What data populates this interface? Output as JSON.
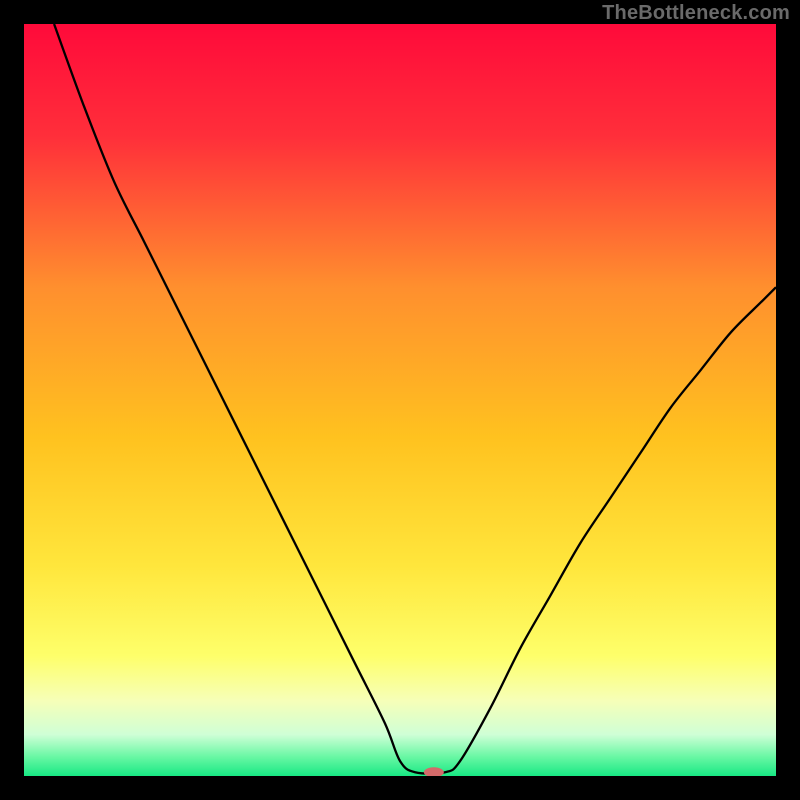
{
  "watermark": "TheBottleneck.com",
  "chart_data": {
    "type": "line",
    "title": "",
    "xlabel": "",
    "ylabel": "",
    "xlim": [
      0,
      100
    ],
    "ylim": [
      0,
      100
    ],
    "background_gradient": {
      "stops": [
        {
          "offset": 0.0,
          "color": "#ff0a3a"
        },
        {
          "offset": 0.15,
          "color": "#ff2f3a"
        },
        {
          "offset": 0.35,
          "color": "#ff8f2e"
        },
        {
          "offset": 0.55,
          "color": "#ffc21f"
        },
        {
          "offset": 0.72,
          "color": "#ffe63c"
        },
        {
          "offset": 0.84,
          "color": "#feff6a"
        },
        {
          "offset": 0.9,
          "color": "#f6ffb8"
        },
        {
          "offset": 0.945,
          "color": "#cfffd6"
        },
        {
          "offset": 0.975,
          "color": "#67f7a3"
        },
        {
          "offset": 1.0,
          "color": "#18e884"
        }
      ]
    },
    "series": [
      {
        "name": "bottleneck-curve",
        "color": "#000000",
        "width": 2.3,
        "points": [
          {
            "x": 4,
            "y": 100
          },
          {
            "x": 8,
            "y": 89
          },
          {
            "x": 12,
            "y": 79
          },
          {
            "x": 16,
            "y": 71
          },
          {
            "x": 20,
            "y": 63
          },
          {
            "x": 24,
            "y": 55
          },
          {
            "x": 28,
            "y": 47
          },
          {
            "x": 32,
            "y": 39
          },
          {
            "x": 36,
            "y": 31
          },
          {
            "x": 40,
            "y": 23
          },
          {
            "x": 44,
            "y": 15
          },
          {
            "x": 48,
            "y": 7
          },
          {
            "x": 50,
            "y": 2
          },
          {
            "x": 52,
            "y": 0.5
          },
          {
            "x": 56,
            "y": 0.5
          },
          {
            "x": 58,
            "y": 2
          },
          {
            "x": 62,
            "y": 9
          },
          {
            "x": 66,
            "y": 17
          },
          {
            "x": 70,
            "y": 24
          },
          {
            "x": 74,
            "y": 31
          },
          {
            "x": 78,
            "y": 37
          },
          {
            "x": 82,
            "y": 43
          },
          {
            "x": 86,
            "y": 49
          },
          {
            "x": 90,
            "y": 54
          },
          {
            "x": 94,
            "y": 59
          },
          {
            "x": 98,
            "y": 63
          },
          {
            "x": 100,
            "y": 65
          }
        ]
      }
    ],
    "marker": {
      "name": "optimum-marker",
      "x": 54.5,
      "y": 0.5,
      "rx": 10,
      "ry": 5,
      "color": "#d46a6a"
    }
  }
}
